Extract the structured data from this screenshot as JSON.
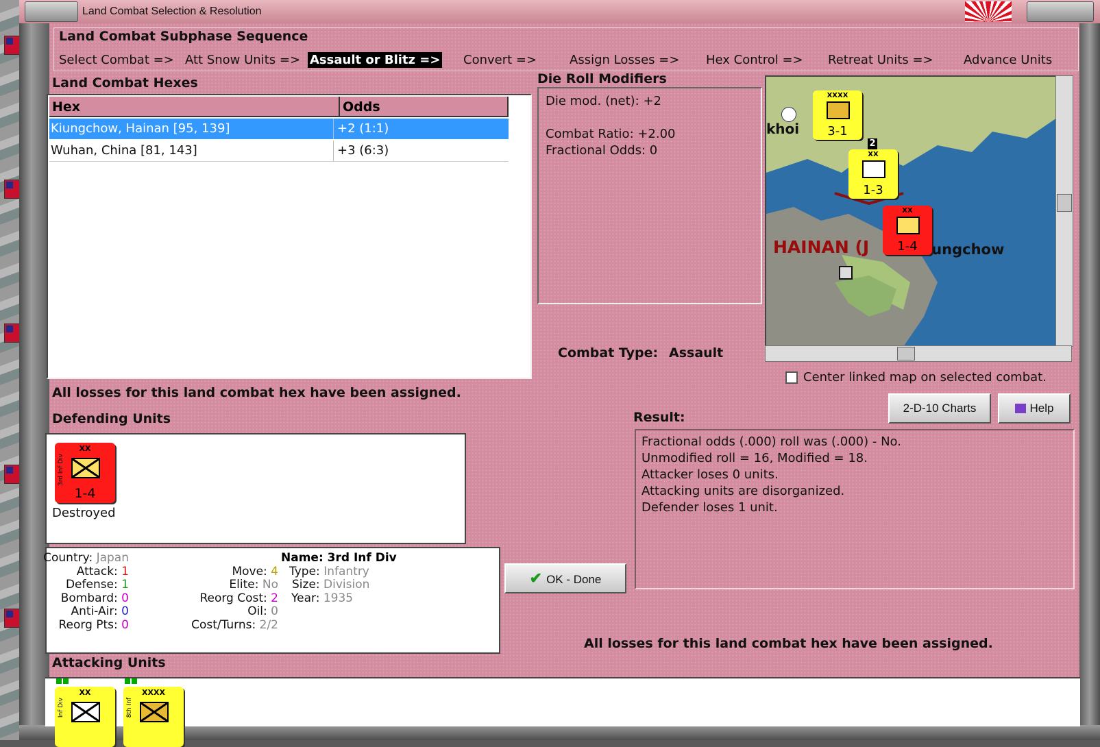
{
  "window": {
    "title": "Land Combat Selection & Resolution"
  },
  "sequence": {
    "heading": "Land Combat Subphase Sequence",
    "steps": [
      "Select Combat =>",
      "Att Snow Units =>",
      "Assault or Blitz =>",
      "Convert =>",
      "Assign Losses =>",
      "Hex Control =>",
      "Retreat Units =>",
      "Advance Units"
    ],
    "active_index": 2
  },
  "hexes": {
    "heading": "Land Combat Hexes",
    "columns": [
      "Hex",
      "Odds"
    ],
    "rows": [
      {
        "hex": "Kiungchow, Hainan [95, 139]",
        "odds": "+2 (1:1)",
        "selected": true
      },
      {
        "hex": "Wuhan, China [81, 143]",
        "odds": "+3 (6:3)",
        "selected": false
      }
    ]
  },
  "die_roll": {
    "heading": "Die Roll Modifiers",
    "lines": [
      "Die mod. (net): +2",
      "",
      "Combat Ratio: +2.00",
      "Fractional Odds: 0"
    ]
  },
  "combat_type": {
    "label": "Combat Type:",
    "value": "Assault"
  },
  "map": {
    "labels": {
      "khoi": "khoi",
      "hainan": "HAINAN (J",
      "kiungchow": "iungchow"
    },
    "units": [
      {
        "size": "XXXX",
        "strength": "3-1",
        "color": "#ffff33"
      },
      {
        "size": "XX",
        "strength": "1-3",
        "color": "#ffff33"
      },
      {
        "size": "XX",
        "strength": "1-4",
        "color": "#ff1a1a"
      }
    ],
    "stack_count": "2"
  },
  "center_map": {
    "label": "Center linked map on selected combat.",
    "checked": false
  },
  "losses_message": "All losses for this land combat hex have been assigned.",
  "buttons": {
    "charts": "2-D-10 Charts",
    "help": "Help",
    "ok": "OK - Done"
  },
  "defending": {
    "heading": "Defending Units",
    "units": [
      {
        "size": "XX",
        "side_label": "3rd Inf Div",
        "strength": "1-4",
        "status": "Destroyed",
        "color": "#ff1a1a"
      }
    ]
  },
  "unit_info": {
    "country_label": "Country:",
    "country": "Japan",
    "attack_label": "Attack:",
    "attack": "1",
    "defense_label": "Defense:",
    "defense": "1",
    "bombard_label": "Bombard:",
    "bombard": "0",
    "antiair_label": "Anti-Air:",
    "antiair": "0",
    "reorgpts_label": "Reorg Pts:",
    "reorgpts": "0",
    "move_label": "Move:",
    "move": "4",
    "elite_label": "Elite:",
    "elite": "No",
    "reorgcost_label": "Reorg Cost:",
    "reorgcost": "2",
    "oil_label": "Oil:",
    "oil": "0",
    "costturns_label": "Cost/Turns:",
    "costturns": "2/2",
    "name_label": "Name:",
    "name": "3rd Inf Div",
    "type_label": "Type:",
    "type": "Infantry",
    "size_label": "Size:",
    "size": "Division",
    "year_label": "Year:",
    "year": "1935"
  },
  "result": {
    "heading": "Result:",
    "lines": [
      "Fractional odds (.000) roll was (.000)  - No.",
      "Unmodified roll = 16, Modified = 18.",
      "Attacker loses 0 units.",
      "Attacking units are disorganized.",
      "Defender loses 1 unit."
    ]
  },
  "attacking": {
    "heading": "Attacking Units",
    "units": [
      {
        "size": "XX",
        "side_label": "Inf Div",
        "color": "#ffff33"
      },
      {
        "size": "XXXX",
        "side_label": "8th Inf",
        "color": "#ffff33"
      }
    ]
  },
  "colors": {
    "panel": "#d48da0",
    "selected_row": "#3399ff",
    "japan_unit": "#ffff33",
    "enemy_unit": "#ff1a1a"
  }
}
